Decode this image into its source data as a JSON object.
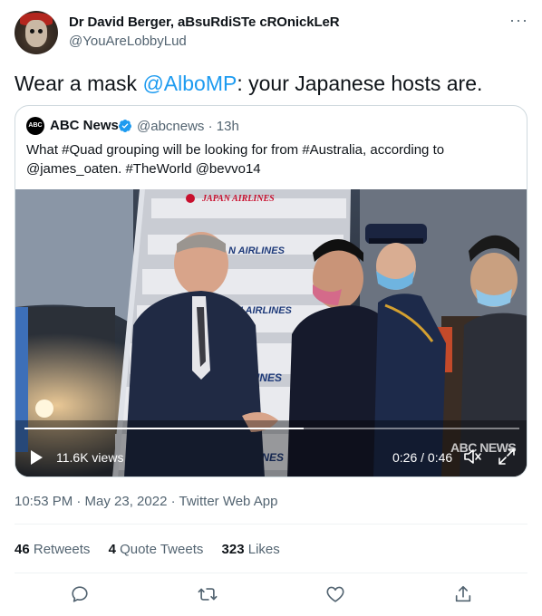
{
  "author": {
    "name": "Dr David Berger, aBsuRdiSTe cROnickLeR",
    "handle": "@YouAreLobbyLud"
  },
  "tweet": {
    "text_before": "Wear a mask ",
    "mention": "@AlboMP",
    "text_after": ": your Japanese hosts are."
  },
  "quote": {
    "logo_text": "ABC",
    "name": "ABC News",
    "handle_time": "@abcnews · 13h",
    "text": "What #Quad grouping will be looking for from #Australia, according to @james_oaten. #TheWorld @bevvo14",
    "video": {
      "views": "11.6K views",
      "time": "0:26 / 0:46",
      "watermark": "ABC NEWS",
      "progress": 0.565,
      "signage": [
        "JAPAN AIRLINES",
        "N AIRLINES",
        "AN AIRLINES",
        "AIRLINES",
        "AIRLINES"
      ]
    }
  },
  "meta": "10:53 PM · May 23, 2022 · Twitter Web App",
  "stats": {
    "retweets_count": "46",
    "retweets_label": "Retweets",
    "quotes_count": "4",
    "quotes_label": "Quote Tweets",
    "likes_count": "323",
    "likes_label": "Likes"
  },
  "colors": {
    "accent": "#1d9bf0",
    "secondary_text": "#536471",
    "border": "#cfd9de"
  },
  "icons": [
    "more-icon",
    "verified-icon",
    "play-icon",
    "volume-icon",
    "fullscreen-icon",
    "reply-icon",
    "retweet-icon",
    "like-icon",
    "share-icon"
  ]
}
